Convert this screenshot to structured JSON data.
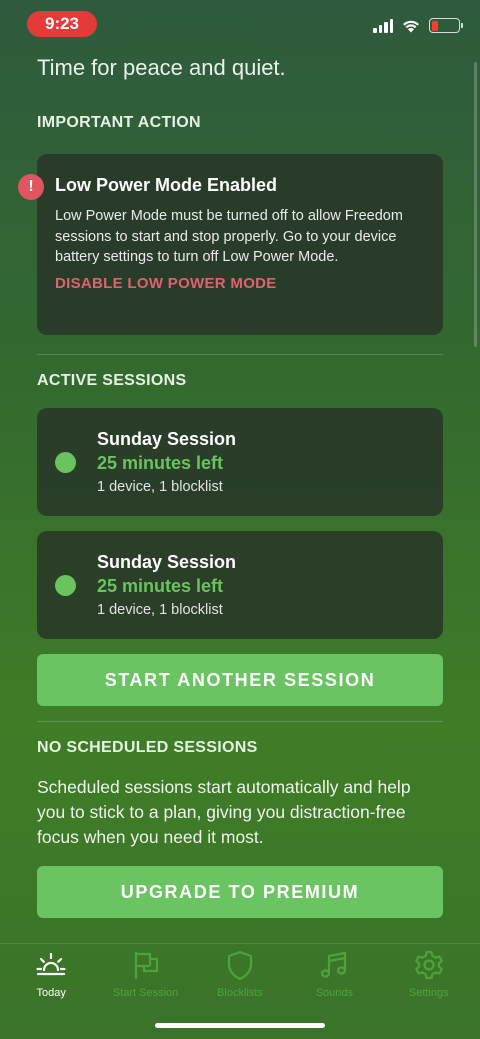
{
  "status_bar": {
    "time": "9:23"
  },
  "tagline": "Time for peace and quiet.",
  "important_action": {
    "section_title": "IMPORTANT ACTION",
    "alert": {
      "title": "Low Power Mode Enabled",
      "body": "Low Power Mode must be turned off to allow Freedom sessions to start and stop properly. Go to your device battery settings to turn off Low Power Mode.",
      "action_label": "DISABLE LOW POWER MODE"
    }
  },
  "active_sessions": {
    "section_title": "ACTIVE SESSIONS",
    "sessions": [
      {
        "name": "Sunday Session",
        "time_left": "25 minutes left",
        "meta": "1 device, 1 blocklist"
      },
      {
        "name": "Sunday Session",
        "time_left": "25 minutes left",
        "meta": "1 device, 1 blocklist"
      }
    ],
    "start_button": "START ANOTHER SESSION"
  },
  "scheduled": {
    "section_title": "NO SCHEDULED SESSIONS",
    "description": "Scheduled sessions start automatically and help you to stick to a plan, giving you distraction-free focus when you need it most.",
    "upgrade_button": "UPGRADE TO PREMIUM"
  },
  "tabs": [
    {
      "label": "Today",
      "icon": "sun-horizon-icon",
      "active": true
    },
    {
      "label": "Start Session",
      "icon": "flag-icon",
      "active": false
    },
    {
      "label": "Blocklists",
      "icon": "shield-icon",
      "active": false
    },
    {
      "label": "Sounds",
      "icon": "music-note-icon",
      "active": false
    },
    {
      "label": "Settings",
      "icon": "gear-icon",
      "active": false
    }
  ],
  "colors": {
    "accent_green": "#6ac462",
    "alert_red": "#e06170",
    "status_time_pill": "#e53a3a",
    "tab_inactive": "#4ea23e"
  }
}
